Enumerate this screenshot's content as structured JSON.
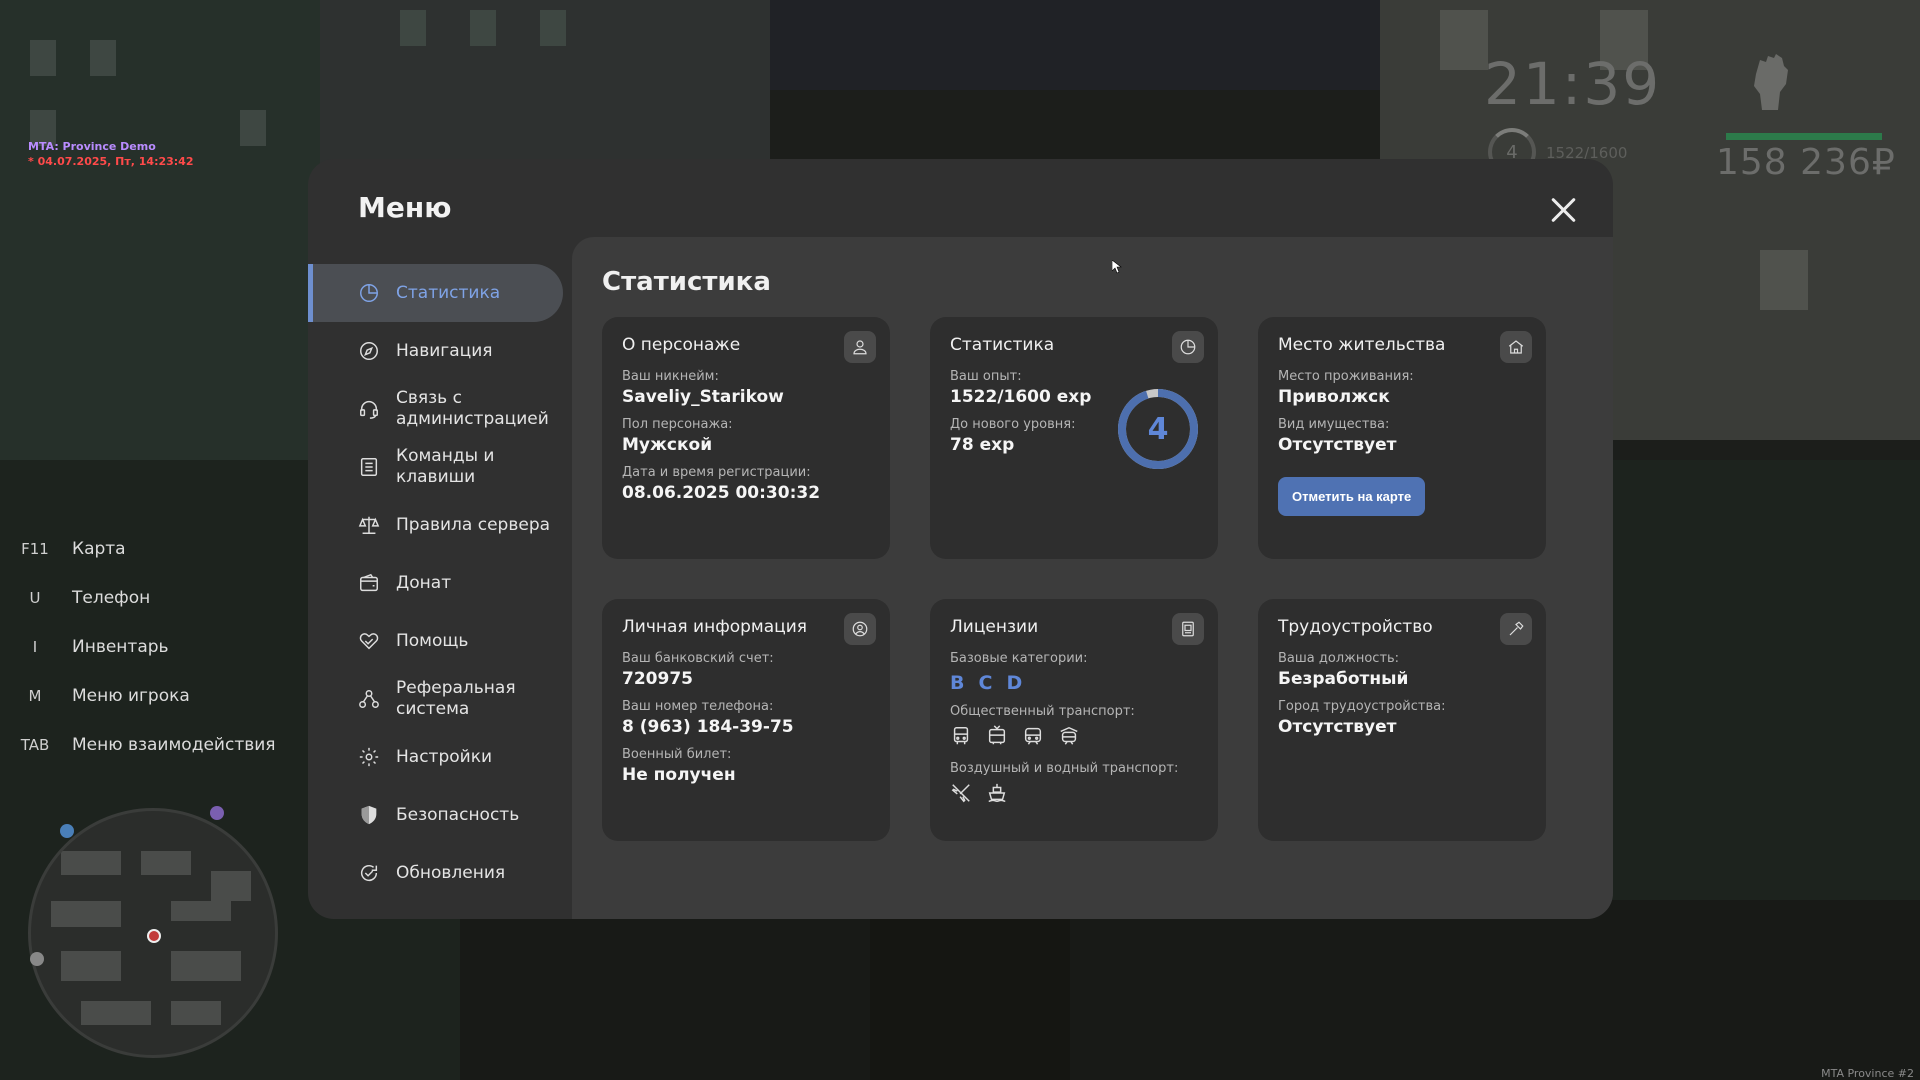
{
  "server": {
    "name": "MTA: Province Demo",
    "datetime": "* 04.07.2025, Пт, 14:23:42",
    "watermark": "MTA Province #2"
  },
  "hud": {
    "time": "21:39",
    "level": "4",
    "exp": "1522/1600",
    "money": "158 236₽",
    "health_color": "#2c7a4a"
  },
  "hotkeys": [
    {
      "key": "F11",
      "label": "Карта"
    },
    {
      "key": "U",
      "label": "Телефон"
    },
    {
      "key": "I",
      "label": "Инвентарь"
    },
    {
      "key": "M",
      "label": "Меню игрока"
    },
    {
      "key": "TAB",
      "label": "Меню взаимодействия"
    }
  ],
  "menu": {
    "title": "Меню",
    "nav": [
      {
        "label": "Статистика",
        "icon": "pie-chart-icon",
        "active": true
      },
      {
        "label": "Навигация",
        "icon": "compass-icon"
      },
      {
        "label": "Связь с администрацией",
        "icon": "headset-icon"
      },
      {
        "label": "Команды и клавиши",
        "icon": "list-icon"
      },
      {
        "label": "Правила сервера",
        "icon": "scales-icon"
      },
      {
        "label": "Донат",
        "icon": "wallet-icon"
      },
      {
        "label": "Помощь",
        "icon": "heart-hand-icon"
      },
      {
        "label": "Реферальная система",
        "icon": "users-network-icon"
      },
      {
        "label": "Настройки",
        "icon": "gear-icon"
      },
      {
        "label": "Безопасность",
        "icon": "shield-icon"
      },
      {
        "label": "Обновления",
        "icon": "refresh-check-icon"
      }
    ]
  },
  "content": {
    "title": "Статистика",
    "about": {
      "title": "О персонаже",
      "nick_label": "Ваш никнейм:",
      "nick": "Saveliy_Starikow",
      "gender_label": "Пол персонажа:",
      "gender": "Мужской",
      "reg_label": "Дата и время регистрации:",
      "reg": "08.06.2025 00:30:32"
    },
    "stats": {
      "title": "Статистика",
      "exp_label": "Ваш опыт:",
      "exp": "1522/1600 exp",
      "next_label": "До нового уровня:",
      "next": "78 exp",
      "level": "4",
      "level_progress": 0.95
    },
    "residence": {
      "title": "Место жительства",
      "place_label": "Место проживания:",
      "place": "Приволжск",
      "property_label": "Вид имущества:",
      "property": "Отсутствует",
      "button": "Отметить на карте"
    },
    "personal": {
      "title": "Личная информация",
      "bank_label": "Ваш банковский счет:",
      "bank": "720975",
      "phone_label": "Ваш номер телефона:",
      "phone": "8 (963) 184-39-75",
      "military_label": "Военный билет:",
      "military": "Не получен"
    },
    "licenses": {
      "title": "Лицензии",
      "base_label": "Базовые категории:",
      "categories": [
        "B",
        "C",
        "D"
      ],
      "public_label": "Общественный транспорт:",
      "air_label": "Воздушный и водный транспорт:"
    },
    "employment": {
      "title": "Трудоустройство",
      "position_label": "Ваша должность:",
      "position": "Безработный",
      "city_label": "Город трудоустройства:",
      "city": "Отсутствует"
    }
  },
  "colors": {
    "accent": "#5f87d8",
    "button": "#4f72b3",
    "panel": "#303030",
    "content": "#3c3c3c",
    "card": "#2e2e2e"
  }
}
